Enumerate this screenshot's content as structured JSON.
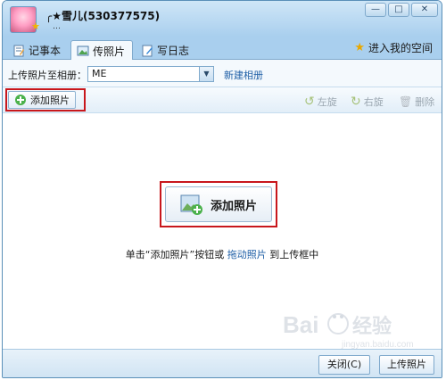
{
  "window": {
    "title": "╭★雪儿(530377575)",
    "subtitle": "…",
    "controls": [
      "—",
      "□",
      "✕"
    ]
  },
  "tabs": [
    {
      "label": "记事本",
      "icon": "notepad-icon"
    },
    {
      "label": "传照片",
      "icon": "photo-icon",
      "active": true
    },
    {
      "label": "写日志",
      "icon": "diary-icon"
    }
  ],
  "my_space": {
    "label": "进入我的空间",
    "icon": "star-icon"
  },
  "album": {
    "label": "上传照片至相册：",
    "selected": "ME",
    "new_album_link": "新建相册"
  },
  "toolbar": {
    "add_photo_label": "添加照片",
    "rotate_left_label": "左旋",
    "rotate_right_label": "右旋",
    "delete_label": "删除"
  },
  "main": {
    "add_photo_big_label": "添加照片",
    "hint_prefix": "单击“添加照片”按钮或",
    "hint_link": "拖动照片",
    "hint_suffix": "到上传框中"
  },
  "footer": {
    "close_label": "关闭(C)",
    "upload_label": "上传照片"
  },
  "watermark": {
    "text": "Bai 经验",
    "url": "jingyan.baidu.com"
  },
  "colors": {
    "highlight": "#c8171c",
    "link": "#1f5fa6",
    "titlebar": "#a9cfee"
  }
}
